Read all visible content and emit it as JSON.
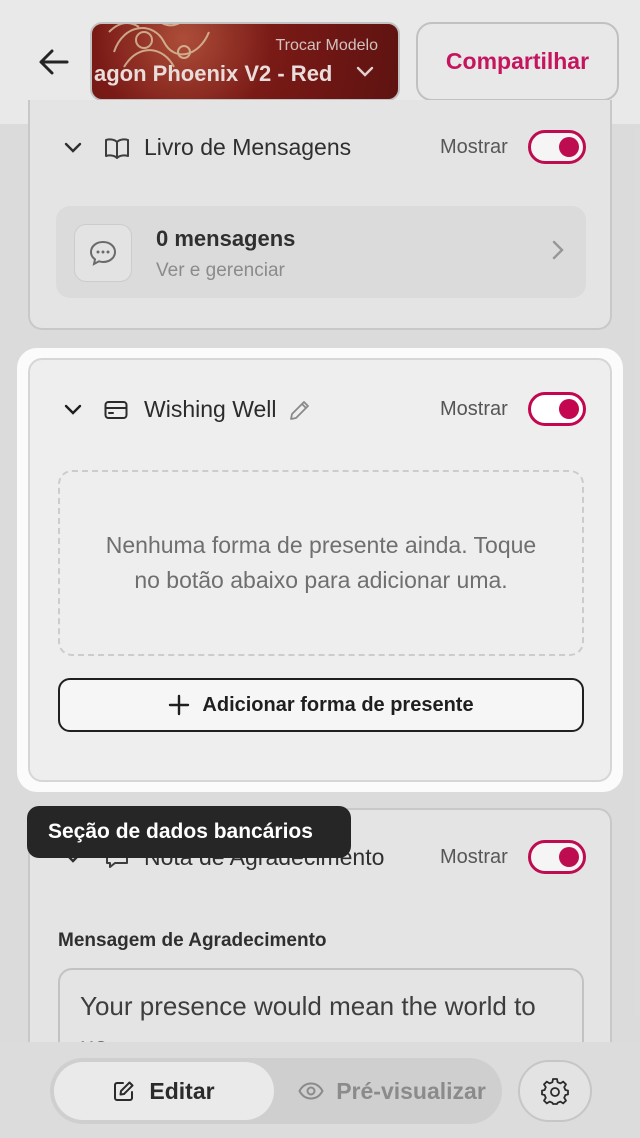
{
  "header": {
    "template_label": "Trocar Modelo",
    "template_name": "agon Phoenix V2 - Red",
    "share_label": "Compartilhar"
  },
  "guestbook": {
    "title": "Livro de Mensagens",
    "show_label": "Mostrar",
    "count_label": "0 mensagens",
    "sub_label": "Ver e gerenciar"
  },
  "wishing_well": {
    "title": "Wishing Well",
    "show_label": "Mostrar",
    "empty_text": "Nenhuma forma de presente ainda. Toque no botão abaixo para adicionar uma.",
    "add_label": "Adicionar forma de presente"
  },
  "tooltip": {
    "text": "Seção de dados bancários"
  },
  "thank_you": {
    "title": "Nota de Agradecimento",
    "show_label": "Mostrar",
    "field_label": "Mensagem de Agradecimento",
    "message": "Your presence would mean the world to us."
  },
  "bottom_bar": {
    "edit_label": "Editar",
    "preview_label": "Pré-visualizar"
  },
  "colors": {
    "accent": "#c4054f",
    "share_text": "#cc0f5e",
    "tooltip_bg": "#262626"
  }
}
